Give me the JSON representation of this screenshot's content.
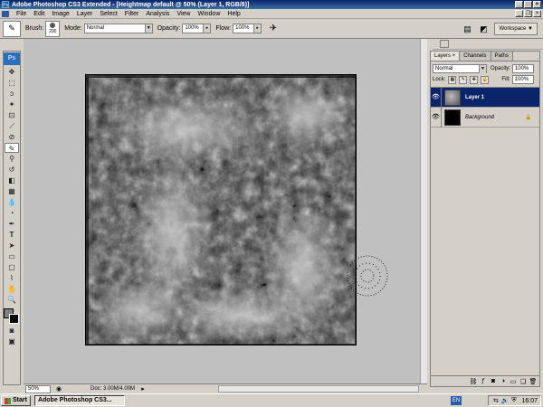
{
  "window": {
    "title": "Adobe Photoshop CS3 Extended - [Heightmap default @ 50% (Layer 1, RGB/8)]",
    "app_icon_label": "Ps"
  },
  "menu": [
    "File",
    "Edit",
    "Image",
    "Layer",
    "Select",
    "Filter",
    "Analysis",
    "View",
    "Window",
    "Help"
  ],
  "options": {
    "brush_label": "Brush:",
    "brush_size": "200",
    "mode_label": "Mode:",
    "mode_value": "Normal",
    "opacity_label": "Opacity:",
    "opacity_value": "100%",
    "flow_label": "Flow:",
    "flow_value": "100%",
    "workspace_label": "Workspace"
  },
  "toolbox": {
    "logo": "Ps",
    "colors": {
      "foreground": "#808080",
      "background": "#000000"
    }
  },
  "status": {
    "zoom": "50%",
    "doc_size": "Doc: 3.00M/4.00M"
  },
  "layers_panel": {
    "tabs": [
      "Layers",
      "Channels",
      "Paths"
    ],
    "blend_mode": "Normal",
    "opacity_label": "Opacity:",
    "opacity_value": "100%",
    "lock_label": "Lock:",
    "fill_label": "Fill:",
    "fill_value": "100%",
    "layers": [
      {
        "name": "Layer 1",
        "selected": true
      },
      {
        "name": "Background",
        "selected": false
      }
    ]
  },
  "taskbar": {
    "start_label": "Start",
    "task_label": "Adobe Photoshop CS3...",
    "language": "EN",
    "clock": "16:07"
  }
}
